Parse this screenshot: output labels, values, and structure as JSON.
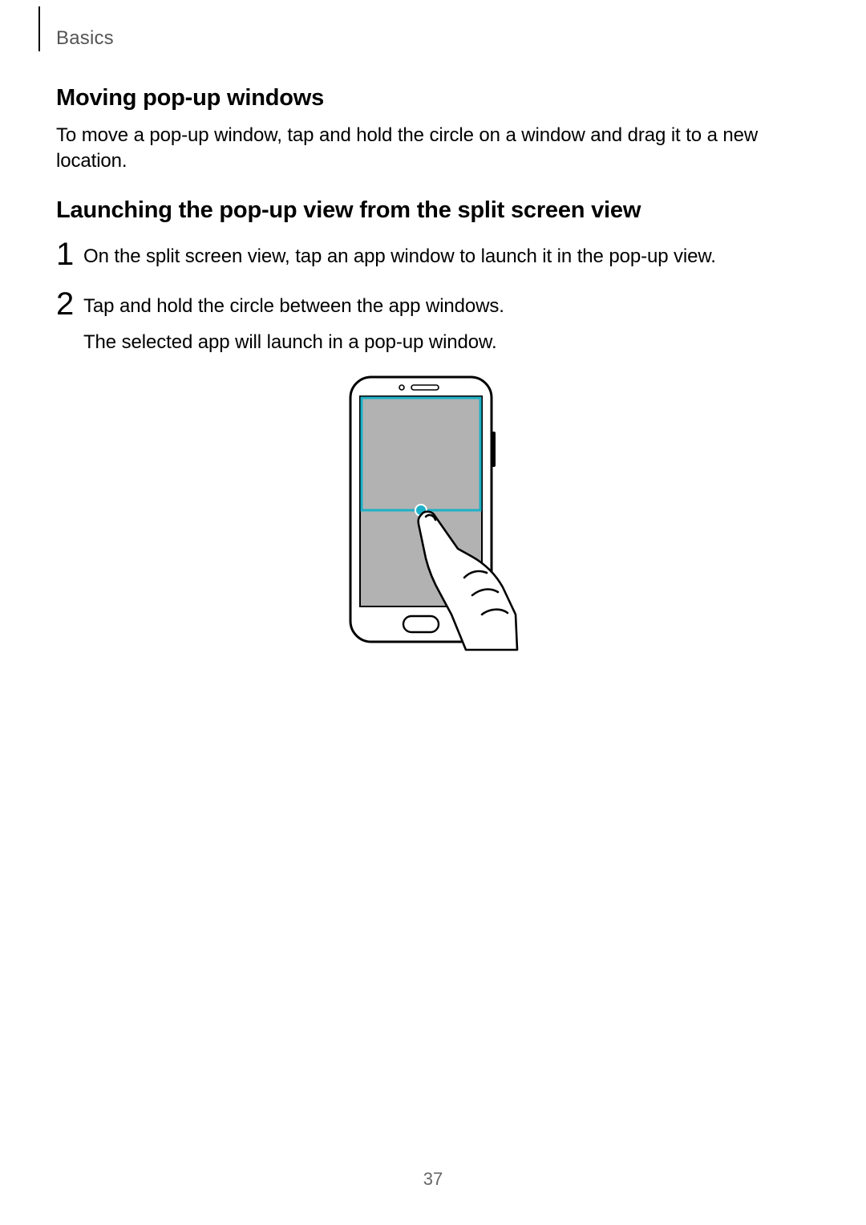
{
  "header": {
    "section": "Basics"
  },
  "sections": {
    "moving": {
      "title": "Moving pop-up windows",
      "body": "To move a pop-up window, tap and hold the circle on a window and drag it to a new location."
    },
    "launching": {
      "title": "Launching the pop-up view from the split screen view",
      "steps": [
        {
          "num": "1",
          "lines": [
            "On the split screen view, tap an app window to launch it in the pop-up view."
          ]
        },
        {
          "num": "2",
          "lines": [
            "Tap and hold the circle between the app windows.",
            "The selected app will launch in a pop-up window."
          ]
        }
      ]
    }
  },
  "figure": {
    "alt": "phone-split-screen-tap-hold-illustration"
  },
  "page_number": "37"
}
